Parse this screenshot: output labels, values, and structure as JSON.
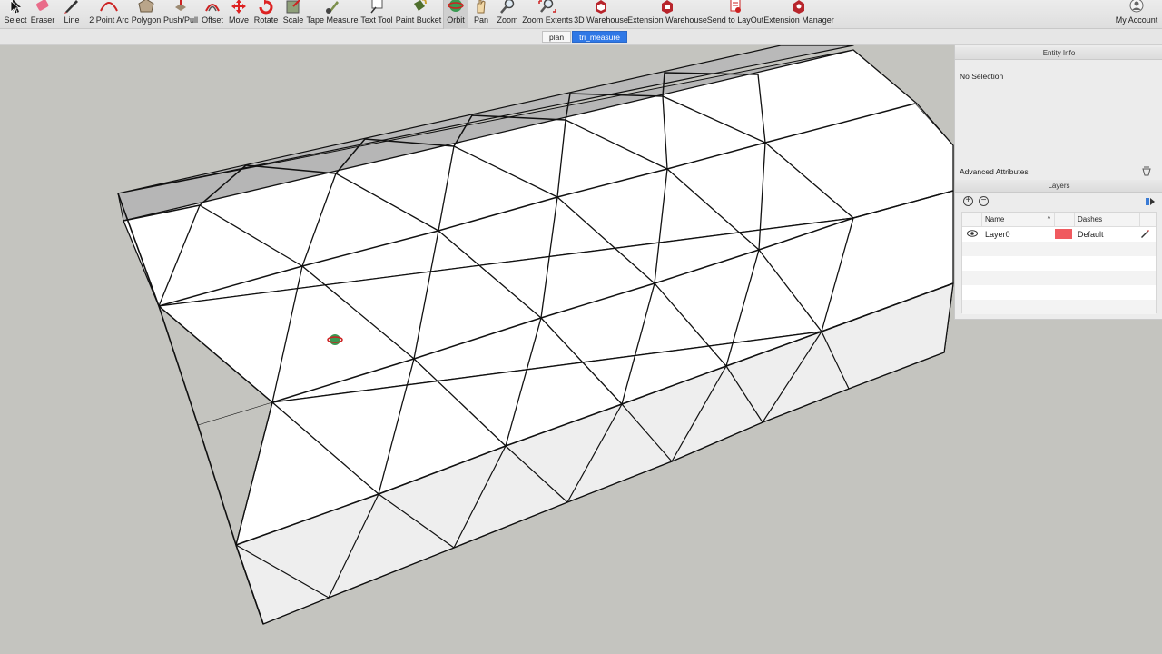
{
  "toolbar": {
    "tools": [
      {
        "label": "Select",
        "icon": "arrow-cursor-icon"
      },
      {
        "label": "Eraser",
        "icon": "eraser-icon"
      },
      {
        "label": "Line",
        "icon": "pencil-icon"
      },
      {
        "label": "2 Point Arc",
        "icon": "arc-icon"
      },
      {
        "label": "Polygon",
        "icon": "polygon-icon"
      },
      {
        "label": "Push/Pull",
        "icon": "push-pull-icon"
      },
      {
        "label": "Offset",
        "icon": "offset-icon"
      },
      {
        "label": "Move",
        "icon": "move-arrows-icon"
      },
      {
        "label": "Rotate",
        "icon": "rotate-icon"
      },
      {
        "label": "Scale",
        "icon": "scale-icon"
      },
      {
        "label": "Tape Measure",
        "icon": "tape-measure-icon"
      },
      {
        "label": "Text Tool",
        "icon": "text-tool-icon"
      },
      {
        "label": "Paint Bucket",
        "icon": "paint-bucket-icon"
      },
      {
        "label": "Orbit",
        "icon": "orbit-icon"
      },
      {
        "label": "Pan",
        "icon": "pan-hand-icon"
      },
      {
        "label": "Zoom",
        "icon": "zoom-magnifier-icon"
      },
      {
        "label": "Zoom Extents",
        "icon": "zoom-extents-icon"
      },
      {
        "label": "3D Warehouse",
        "icon": "3d-warehouse-icon"
      },
      {
        "label": "Extension Warehouse",
        "icon": "extension-warehouse-icon"
      },
      {
        "label": "Send to LayOut",
        "icon": "send-to-layout-icon"
      },
      {
        "label": "Extension Manager",
        "icon": "extension-manager-icon"
      }
    ],
    "active_tool": "Orbit",
    "account_label": "My Account",
    "account_icon": "account-user-icon"
  },
  "scenes": {
    "tabs": [
      {
        "label": "plan",
        "selected": false
      },
      {
        "label": "tri_measure",
        "selected": true
      }
    ]
  },
  "entity_info": {
    "title": "Entity Info",
    "selection_text": "No Selection",
    "advanced_label": "Advanced Attributes"
  },
  "layers": {
    "title": "Layers",
    "columns": {
      "name": "Name",
      "dashes": "Dashes"
    },
    "rows": [
      {
        "name": "Layer0",
        "visible": true,
        "color": "#f05a5f",
        "dashes": "Default"
      }
    ]
  },
  "colors": {
    "accent": "#2f78e6",
    "model_face": "#ffffff",
    "model_back_face": "#efefef",
    "model_top_strip": "#b9b9b9",
    "sky_ground": "#c4c4bf"
  }
}
